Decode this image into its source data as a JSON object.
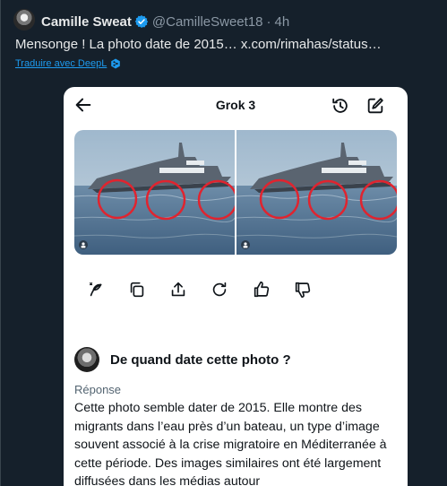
{
  "tweet": {
    "display_name": "Camille Sweat",
    "handle": "@CamilleSweet18",
    "separator": "·",
    "time": "4h",
    "text": "Mensonge ! La photo date de 2015…  x.com/rimahas/status…",
    "translate_label": "Traduire avec DeepL"
  },
  "screenshot": {
    "title": "Grok 3",
    "question": "De quand date cette photo ?",
    "answer_label": "Réponse",
    "answer_text": "Cette photo semble dater de 2015. Elle montre des migrants dans l’eau près d’un bateau, un type d’image souvent associé à la crise migratoire en Méditerranée à cette période. Des images similaires ont été largement diffusées dans les médias autour",
    "actions": [
      "regenerate-icon",
      "copy-icon",
      "share-icon",
      "refresh-icon",
      "thumbs-up-icon",
      "thumbs-down-icon"
    ]
  },
  "colors": {
    "background": "#15202b",
    "accent": "#1d9bf0",
    "circle_marker": "#e0242f"
  }
}
